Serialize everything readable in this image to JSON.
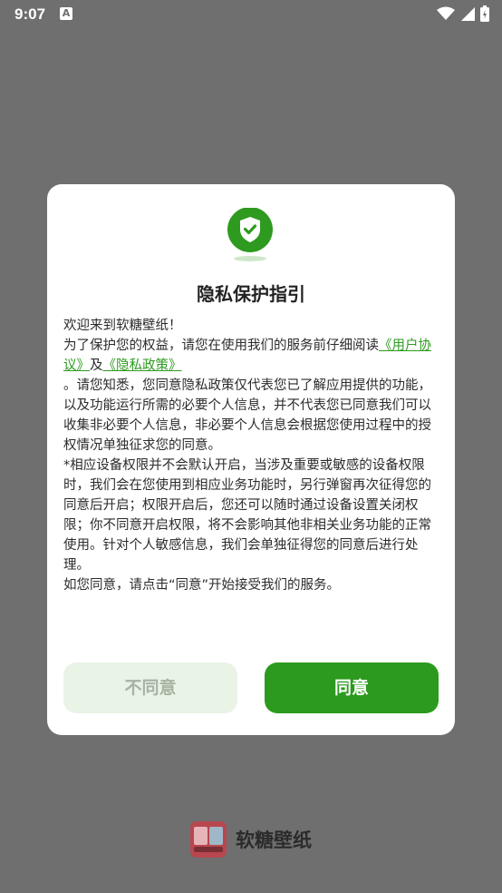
{
  "status": {
    "time": "9:07",
    "notification_icon_letter": "A",
    "icons": [
      "wifi-icon",
      "signal-icon",
      "battery-icon"
    ]
  },
  "dialog": {
    "title": "隐私保护指引",
    "welcome": "欢迎来到软糖壁纸！",
    "intro_prefix": "为了保护您的权益，请您在使用我们的服务前仔细阅读",
    "user_agreement_link": "《用户协议》",
    "and": "及",
    "privacy_policy_link": "《隐私政策》",
    "paragraph1": "。请您知悉，您同意隐私政策仅代表您已了解应用提供的功能，以及功能运行所需的必要个人信息，并不代表您已同意我们可以收集非必要个人信息，非必要个人信息会根据您使用过程中的授权情况单独征求您的同意。",
    "paragraph2": "*相应设备权限并不会默认开启，当涉及重要或敏感的设备权限时，我们会在您使用到相应业务功能时，另行弹窗再次征得您的同意后开启；权限开启后，您还可以随时通过设备设置关闭权限；你不同意开启权限，将不会影响其他非相关业务功能的正常使用。针对个人敏感信息，我们会单独征得您的同意后进行处理。",
    "paragraph3": "如您同意，请点击“同意”开始接受我们的服务。",
    "decline_label": "不同意",
    "agree_label": "同意"
  },
  "footer": {
    "app_name": "软糖壁纸"
  },
  "colors": {
    "accent": "#2c9a1e",
    "link": "#2e9a1f",
    "scrim": "#6f6f6f"
  }
}
